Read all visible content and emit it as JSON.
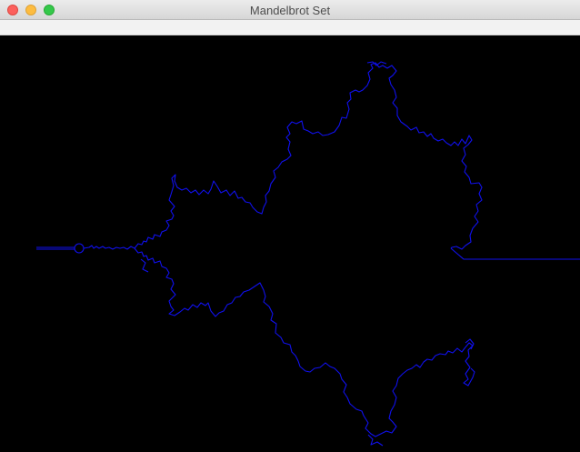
{
  "window": {
    "title": "Mandelbrot Set"
  },
  "colors": {
    "background": "#000000",
    "fractal_outline": "#0000ff",
    "close_button": "#fc605c",
    "minimize_button": "#fdbc40",
    "zoom_button": "#34c84a"
  },
  "icons": [
    "close-icon",
    "minimize-icon",
    "zoom-icon"
  ]
}
